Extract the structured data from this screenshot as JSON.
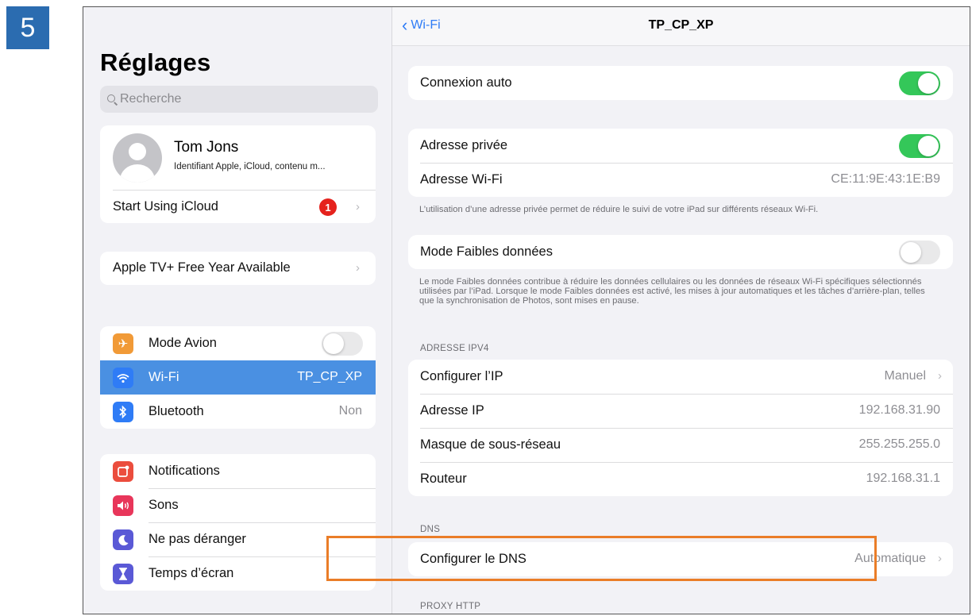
{
  "step_number": "5",
  "sidebar": {
    "title": "Réglages",
    "search_placeholder": "Recherche",
    "profile": {
      "name": "Tom Jons",
      "subtitle": "Identifiant Apple, iCloud, contenu m...",
      "icloud_label": "Start Using iCloud",
      "icloud_badge": "1"
    },
    "promo_label": "Apple TV+ Free Year Available",
    "connectivity": [
      {
        "label": "Mode Avion",
        "icon": "airplane-icon",
        "color": "#f19a37",
        "toggle": false
      },
      {
        "label": "Wi-Fi",
        "icon": "wifi-icon",
        "color": "#2f7cf6",
        "value": "TP_CP_XP",
        "selected": true
      },
      {
        "label": "Bluetooth",
        "icon": "bluetooth-icon",
        "color": "#2f7cf6",
        "value": "Non"
      }
    ],
    "system": [
      {
        "label": "Notifications",
        "icon": "notifications-icon",
        "color": "#eb4d3d"
      },
      {
        "label": "Sons",
        "icon": "speaker-icon",
        "color": "#e8365a"
      },
      {
        "label": "Ne pas déranger",
        "icon": "moon-icon",
        "color": "#5a59d6"
      },
      {
        "label": "Temps d’écran",
        "icon": "hourglass-icon",
        "color": "#5a59d6"
      }
    ]
  },
  "main": {
    "back_label": "Wi-Fi",
    "title": "TP_CP_XP",
    "auto_join": {
      "label": "Connexion auto",
      "on": true
    },
    "private_address": {
      "label": "Adresse privée",
      "on": true
    },
    "wifi_address": {
      "label": "Adresse Wi-Fi",
      "value": "CE:11:9E:43:1E:B9"
    },
    "private_note": "L’utilisation d’une adresse privée permet de réduire le suivi de votre iPad sur différents réseaux Wi-Fi.",
    "low_data": {
      "label": "Mode Faibles données",
      "on": false
    },
    "low_data_note": "Le mode Faibles données contribue à réduire les données cellulaires ou les données de réseaux Wi-Fi spécifiques sélectionnés utilisées par l’iPad. Lorsque le mode Faibles données est activé, les mises à jour automatiques et les tâches d’arrière-plan, telles que la synchronisation de Photos, sont mises en pause.",
    "ipv4_header": "ADRESSE IPV4",
    "ipv4": {
      "configure_label": "Configurer l’IP",
      "configure_value": "Manuel",
      "ip_label": "Adresse IP",
      "ip_value": "192.168.31.90",
      "mask_label": "Masque de sous-réseau",
      "mask_value": "255.255.255.0",
      "router_label": "Routeur",
      "router_value": "192.168.31.1"
    },
    "dns_header": "DNS",
    "dns": {
      "label": "Configurer le DNS",
      "value": "Automatique"
    },
    "proxy_header": "PROXY HTTP"
  },
  "colors": {
    "accent": "#2f7cf6",
    "toggle_on": "#34c759",
    "highlight": "#ea7d28",
    "step_badge": "#2b6cb0"
  }
}
